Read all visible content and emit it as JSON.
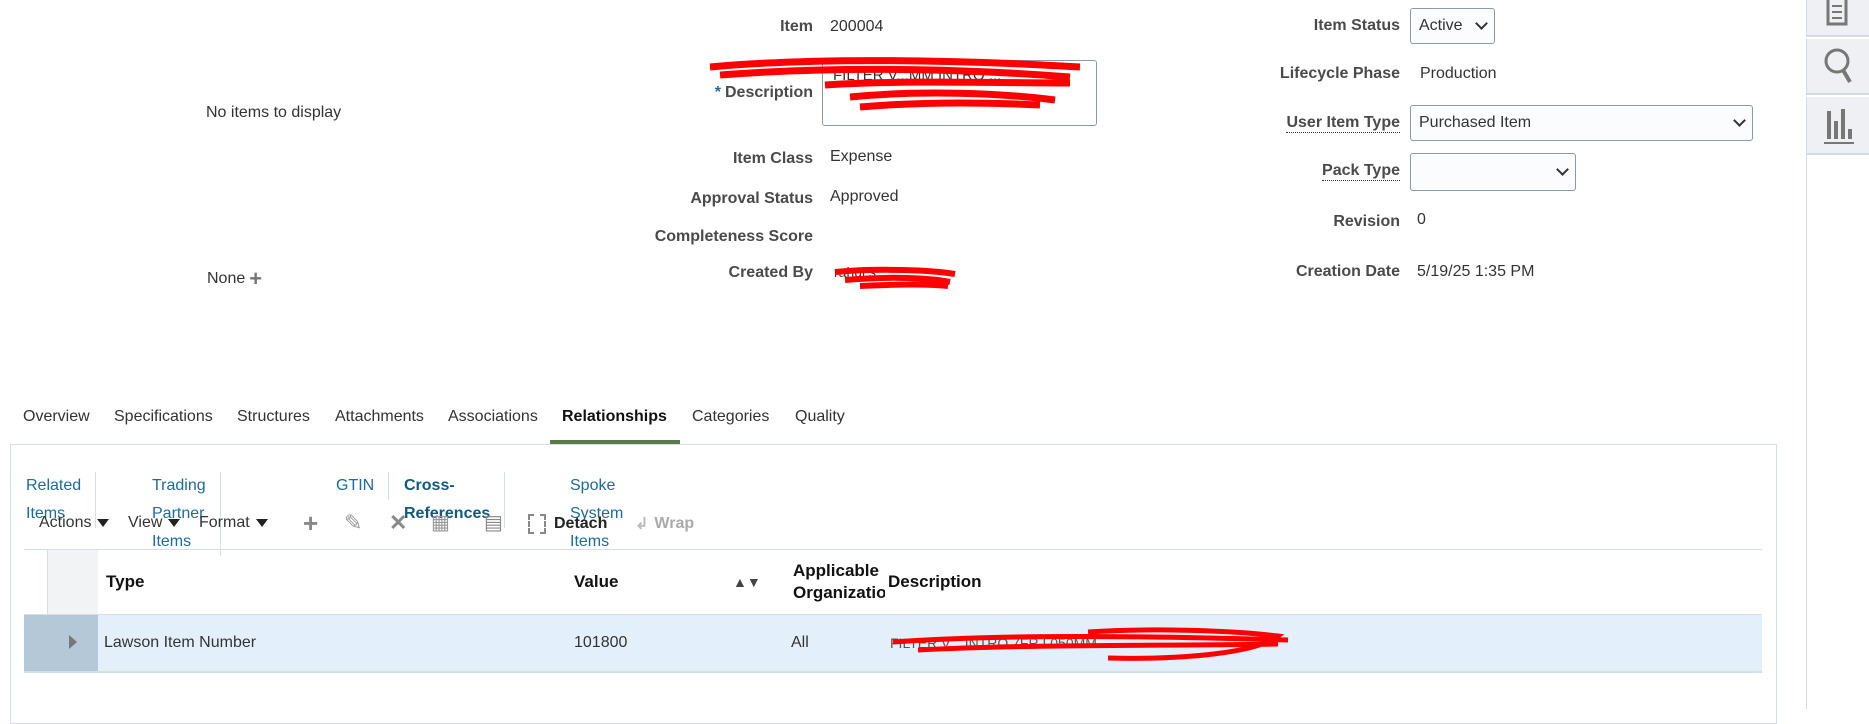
{
  "left": {
    "no_items": "No items to display",
    "none_label": "None"
  },
  "form": {
    "item_label": "Item",
    "item_value": "200004",
    "required_mark": "*",
    "description_label": "Description",
    "description_value": "FILTER V...MM INTRO ...",
    "item_class_label": "Item Class",
    "item_class_value": "Expense",
    "approval_status_label": "Approval Status",
    "approval_status_value": "Approved",
    "completeness_label": "Completeness Score",
    "created_by_label": "Created By",
    "created_by_value": "rahul.s..."
  },
  "right": {
    "item_status_label": "Item Status",
    "item_status_value": "Active",
    "lifecycle_label": "Lifecycle Phase",
    "lifecycle_value": "Production",
    "user_item_type_label": "User Item Type",
    "user_item_type_value": "Purchased Item",
    "pack_type_label": "Pack Type",
    "pack_type_value": "",
    "revision_label": "Revision",
    "revision_value": "0",
    "creation_date_label": "Creation Date",
    "creation_date_value": "5/19/25 1:35 PM"
  },
  "tabs": [
    "Overview",
    "Specifications",
    "Structures",
    "Attachments",
    "Associations",
    "Relationships",
    "Categories",
    "Quality"
  ],
  "subtabs": [
    "Related Items",
    "Trading Partner Items",
    "GTIN",
    "Cross-References",
    "Spoke System Items"
  ],
  "toolbar": {
    "actions": "Actions",
    "view": "View",
    "format": "Format",
    "detach": "Detach",
    "wrap": "Wrap"
  },
  "table": {
    "headers": {
      "type": "Type",
      "value": "Value",
      "org_line1": "Applicable",
      "org_line2": "Organization",
      "description": "Description"
    },
    "rows": [
      {
        "type": "Lawson Item Number",
        "value": "101800",
        "org": "All",
        "description": "FILTER V... INTRO 7FR L050MM"
      }
    ]
  },
  "colors": {
    "accent": "#1a6c9c",
    "tab_underline": "#5a7a4a",
    "row_selected": "#e3f0fb",
    "redaction": "#ff0000"
  }
}
